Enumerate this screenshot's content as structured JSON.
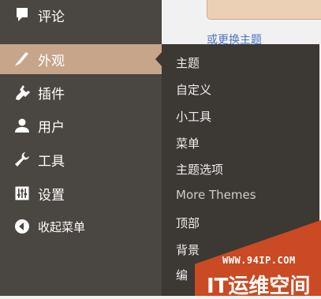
{
  "colors": {
    "sidebar_bg": "#4a4641",
    "flyout_bg": "#3c3834",
    "active_bg": "#c7a58a",
    "content_bg": "#f1f1f1",
    "link": "#4b74c4",
    "watermark": "#c94a23"
  },
  "sidebar": {
    "items": [
      {
        "icon": "comment-icon",
        "label": "评论"
      },
      {
        "icon": "paintbrush-icon",
        "label": "外观",
        "active": true
      },
      {
        "icon": "plugin-icon",
        "label": "插件"
      },
      {
        "icon": "user-icon",
        "label": "用户"
      },
      {
        "icon": "wrench-icon",
        "label": "工具"
      },
      {
        "icon": "settings-sliders-icon",
        "label": "设置"
      },
      {
        "icon": "collapse-arrow-icon",
        "label": "收起菜单"
      }
    ]
  },
  "flyout": {
    "items": [
      {
        "label": "主题"
      },
      {
        "label": "自定义"
      },
      {
        "label": "小工具"
      },
      {
        "label": "菜单"
      },
      {
        "label": "主题选项"
      },
      {
        "label": "More Themes"
      },
      {
        "label": "顶部"
      },
      {
        "label": "背景"
      },
      {
        "label": "编"
      }
    ]
  },
  "content": {
    "link_text": "或更换主题"
  },
  "watermark": {
    "url": "WWW.94IP.COM",
    "brand": "IT运维空间"
  }
}
